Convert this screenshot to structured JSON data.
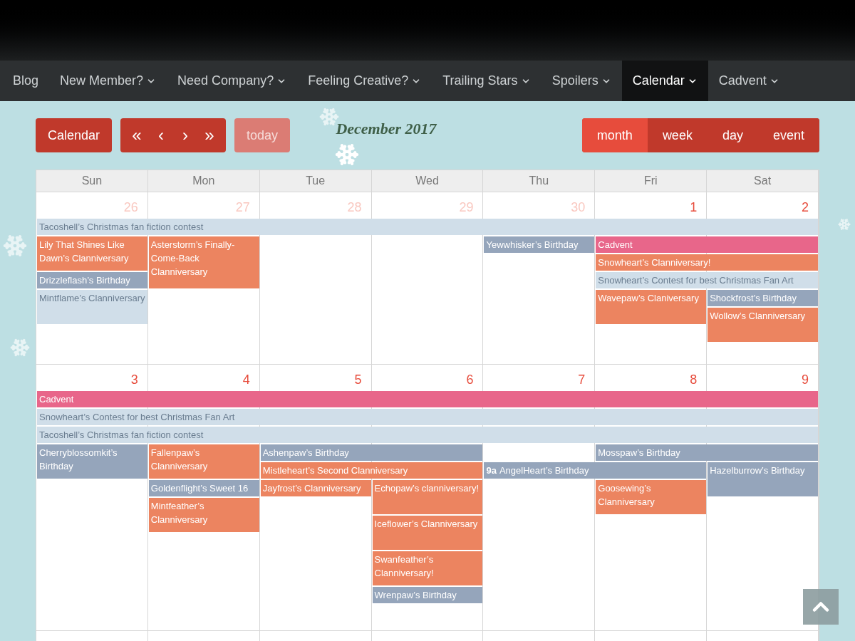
{
  "nav": [
    {
      "label": "Blog",
      "has_menu": false,
      "selected": false
    },
    {
      "label": "New Member?",
      "has_menu": true,
      "selected": false
    },
    {
      "label": "Need Company?",
      "has_menu": true,
      "selected": false
    },
    {
      "label": "Feeling Creative?",
      "has_menu": true,
      "selected": false
    },
    {
      "label": "Trailing Stars",
      "has_menu": true,
      "selected": false
    },
    {
      "label": "Spoilers",
      "has_menu": true,
      "selected": false
    },
    {
      "label": "Calendar",
      "has_menu": true,
      "selected": true
    },
    {
      "label": "Cadvent",
      "has_menu": true,
      "selected": false
    }
  ],
  "toolbar": {
    "calendar_button": "Calendar",
    "nav_buttons": [
      "«",
      "‹",
      "›",
      "»"
    ],
    "today": {
      "label": "today",
      "disabled": true
    },
    "title": "December 2017",
    "views": [
      {
        "label": "month",
        "selected": true
      },
      {
        "label": "week",
        "selected": false
      },
      {
        "label": "day",
        "selected": false
      },
      {
        "label": "event",
        "selected": false
      }
    ]
  },
  "weekdays": [
    "Sun",
    "Mon",
    "Tue",
    "Wed",
    "Thu",
    "Fri",
    "Sat"
  ],
  "weeks": [
    {
      "days": [
        {
          "number": "26",
          "other_month": true
        },
        {
          "number": "27",
          "other_month": true
        },
        {
          "number": "28",
          "other_month": true
        },
        {
          "number": "29",
          "other_month": true
        },
        {
          "number": "30",
          "other_month": true
        },
        {
          "number": "1",
          "other_month": false
        },
        {
          "number": "2",
          "other_month": false
        }
      ],
      "events": [
        {
          "title": "Tacoshell’s Christmas fan fiction contest",
          "color": "#d0dee9"
        },
        {
          "title": "Lily That Shines Like Dawn’s Clanniversary",
          "color": "#ec8460"
        },
        {
          "title": "Asterstorm’s Finally-Come-Back Clanniversary",
          "color": "#ec8460"
        },
        {
          "title": "Yewwhisker’s Birthday",
          "color": "#95a5bb"
        },
        {
          "title": "Cadvent",
          "color": "#e8668a"
        },
        {
          "title": "Drizzleflash’s Birthday",
          "color": "#95a5bb"
        },
        {
          "title": "Snowheart’s Clanniversary!",
          "color": "#ec8460"
        },
        {
          "title": "Mintflame’s Clanniversary",
          "color": "#d0dee9"
        },
        {
          "title": "Snowheart’s Contest for best Christmas Fan Art",
          "color": "#d0dee9"
        },
        {
          "title": "Wavepaw’s Claniversary",
          "color": "#ec8460"
        },
        {
          "title": "Shockfrost’s Birthday",
          "color": "#95a5bb"
        },
        {
          "title": "Wollow’s Clanniversary",
          "color": "#ec8460"
        }
      ]
    },
    {
      "days": [
        {
          "number": "3",
          "other_month": false
        },
        {
          "number": "4",
          "other_month": false
        },
        {
          "number": "5",
          "other_month": false
        },
        {
          "number": "6",
          "other_month": false
        },
        {
          "number": "7",
          "other_month": false
        },
        {
          "number": "8",
          "other_month": false
        },
        {
          "number": "9",
          "other_month": false
        }
      ],
      "events": [
        {
          "title": "Cadvent",
          "color": "#e8668a"
        },
        {
          "title": "Snowheart’s Contest for best Christmas Fan Art",
          "color": "#d0dee9"
        },
        {
          "title": "Tacoshell’s Christmas fan fiction contest",
          "color": "#d0dee9"
        },
        {
          "title": "Cherryblossomkit’s Birthday",
          "color": "#95a5bb"
        },
        {
          "title": "Fallenpaw’s Clanniversary",
          "color": "#ec8460"
        },
        {
          "title": "Ashenpaw’s Birthday",
          "color": "#95a5bb"
        },
        {
          "title": "Mosspaw’s Birthday",
          "color": "#95a5bb"
        },
        {
          "title": "Goldenflight’s Sweet 16",
          "color": "#95a5bb"
        },
        {
          "title": "Mistleheart’s Second Clanniversary",
          "color": "#ec8460"
        },
        {
          "time": "9a",
          "title": "AngelHeart’s Birthday",
          "color": "#95a5bb"
        },
        {
          "title": "Hazelburrow’s Birthday",
          "color": "#95a5bb"
        },
        {
          "title": "Mintfeather’s Clanniversary",
          "color": "#ec8460"
        },
        {
          "title": "Jayfrost’s Clanniversary",
          "color": "#ec8460"
        },
        {
          "title": "Echopaw’s clanniversary!",
          "color": "#ec8460"
        },
        {
          "title": "Goosewing’s Clanniversary",
          "color": "#ec8460"
        },
        {
          "title": "Iceflower’s Clanniversary",
          "color": "#ec8460"
        },
        {
          "title": "Swanfeather’s Clanniversary!",
          "color": "#ec8460"
        },
        {
          "title": "Wrenpaw’s Birthday",
          "color": "#95a5bb"
        }
      ]
    }
  ]
}
